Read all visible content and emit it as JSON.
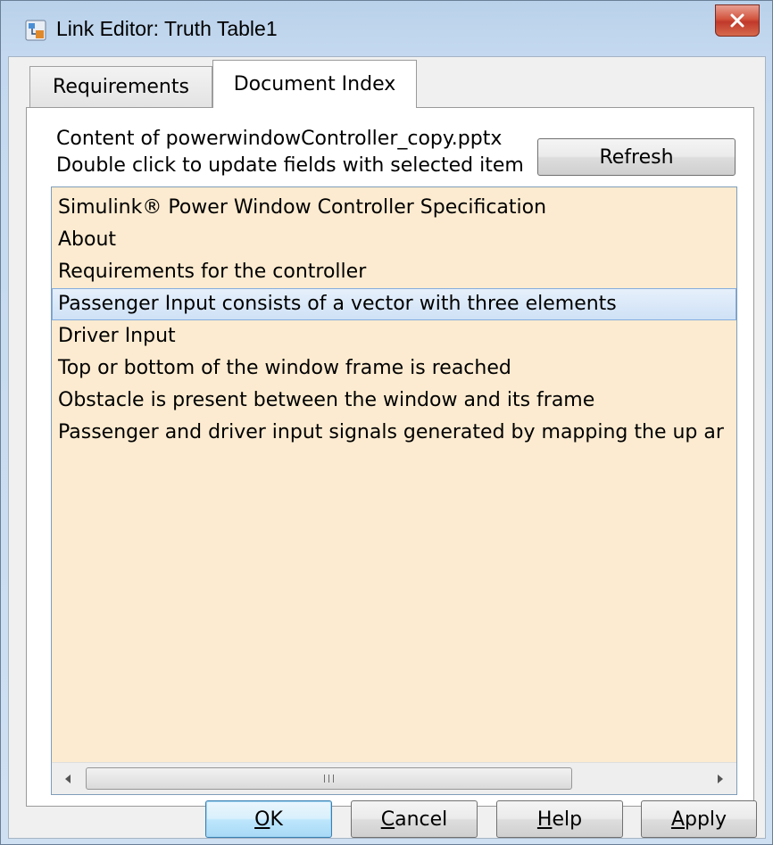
{
  "window": {
    "title": "Link Editor: Truth Table1",
    "icon": "link-editor-app-icon",
    "close_icon": "close-icon"
  },
  "tabs": [
    {
      "label": "Requirements",
      "active": false
    },
    {
      "label": "Document Index",
      "active": true
    }
  ],
  "document_index": {
    "content_line": "Content of powerwindowController_copy.pptx",
    "hint_line": "Double click to update fields with selected item",
    "refresh_label": "Refresh",
    "items": [
      "Simulink® Power Window Controller Specification",
      "About",
      "Requirements for the controller",
      "Passenger Input  consists of a vector with three elements",
      "Driver Input",
      "Top or bottom of the window frame is reached",
      "Obstacle is present between the window and its frame",
      "Passenger and driver input signals generated by mapping the up ar"
    ],
    "selected_index": 3,
    "list_background": "#fcebd0",
    "selection_color": "#cfe1f6"
  },
  "buttons": {
    "ok": {
      "mnemonic": "O",
      "rest": "K"
    },
    "cancel": {
      "mnemonic": "C",
      "rest": "ancel"
    },
    "help": {
      "mnemonic": "H",
      "rest": "elp"
    },
    "apply": {
      "mnemonic": "A",
      "rest": "pply"
    }
  },
  "colors": {
    "close_button": "#c0392b",
    "default_button_border": "#3c7fb1"
  }
}
